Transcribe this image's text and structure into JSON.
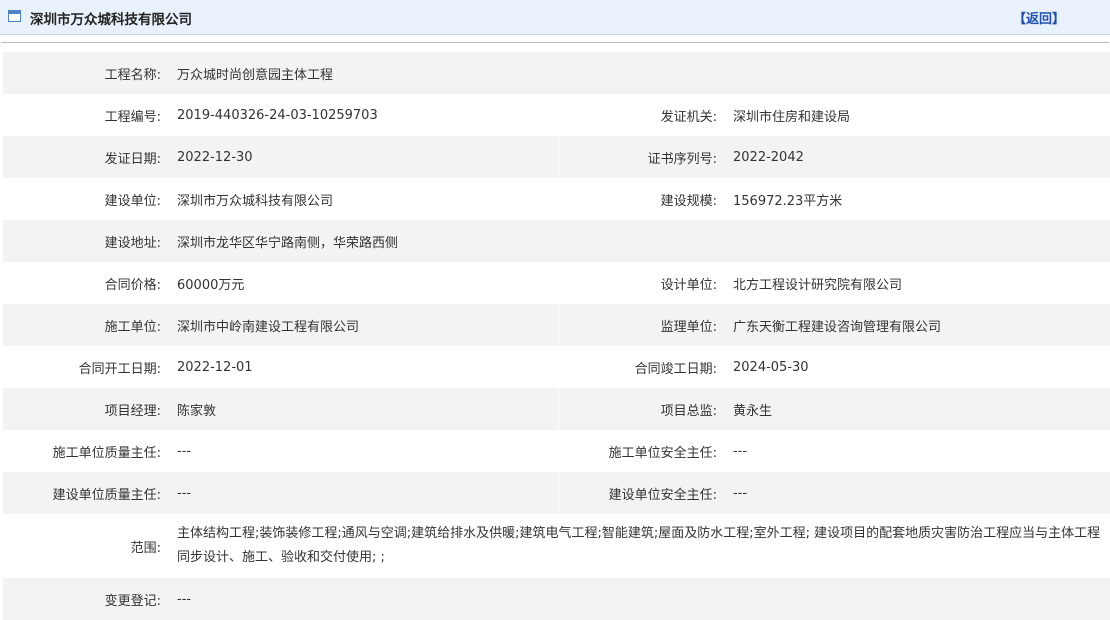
{
  "header": {
    "title": "深圳市万众城科技有限公司",
    "back_label": "【返回】"
  },
  "fields": {
    "project_name_label": "工程名称:",
    "project_name": "万众城时尚创意园主体工程",
    "project_no_label": "工程编号:",
    "project_no": "2019-440326-24-03-10259703",
    "issuer_label": "发证机关:",
    "issuer": "深圳市住房和建设局",
    "issue_date_label": "发证日期:",
    "issue_date": "2022-12-30",
    "cert_serial_label": "证书序列号:",
    "cert_serial": "2022-2042",
    "builder_label": "建设单位:",
    "builder": "深圳市万众城科技有限公司",
    "scale_label": "建设规模:",
    "scale": "156972.23平方米",
    "address_label": "建设地址:",
    "address": "深圳市龙华区华宁路南侧，华荣路西侧",
    "price_label": "合同价格:",
    "price": "60000万元",
    "design_label": "设计单位:",
    "design": "北方工程设计研究院有限公司",
    "construction_label": "施工单位:",
    "construction": "深圳市中岭南建设工程有限公司",
    "supervision_label": "监理单位:",
    "supervision": "广东天衡工程建设咨询管理有限公司",
    "start_date_label": "合同开工日期:",
    "start_date": "2022-12-01",
    "end_date_label": "合同竣工日期:",
    "end_date": "2024-05-30",
    "pm_label": "项目经理:",
    "pm": "陈家敦",
    "chief_supervisor_label": "项目总监:",
    "chief_supervisor": "黄永生",
    "cons_quality_label": "施工单位质量主任:",
    "cons_quality": "---",
    "cons_safety_label": "施工单位安全主任:",
    "cons_safety": "---",
    "build_quality_label": "建设单位质量主任:",
    "build_quality": "---",
    "build_safety_label": "建设单位安全主任:",
    "build_safety": "---",
    "scope_label": "范围:",
    "scope": "主体结构工程;装饰装修工程;通风与空调;建筑给排水及供暖;建筑电气工程;智能建筑;屋面及防水工程;室外工程; 建设项目的配套地质灾害防治工程应当与主体工程同步设计、施工、验收和交付使用; ;",
    "change_label": "变更登记:",
    "change": "---"
  }
}
